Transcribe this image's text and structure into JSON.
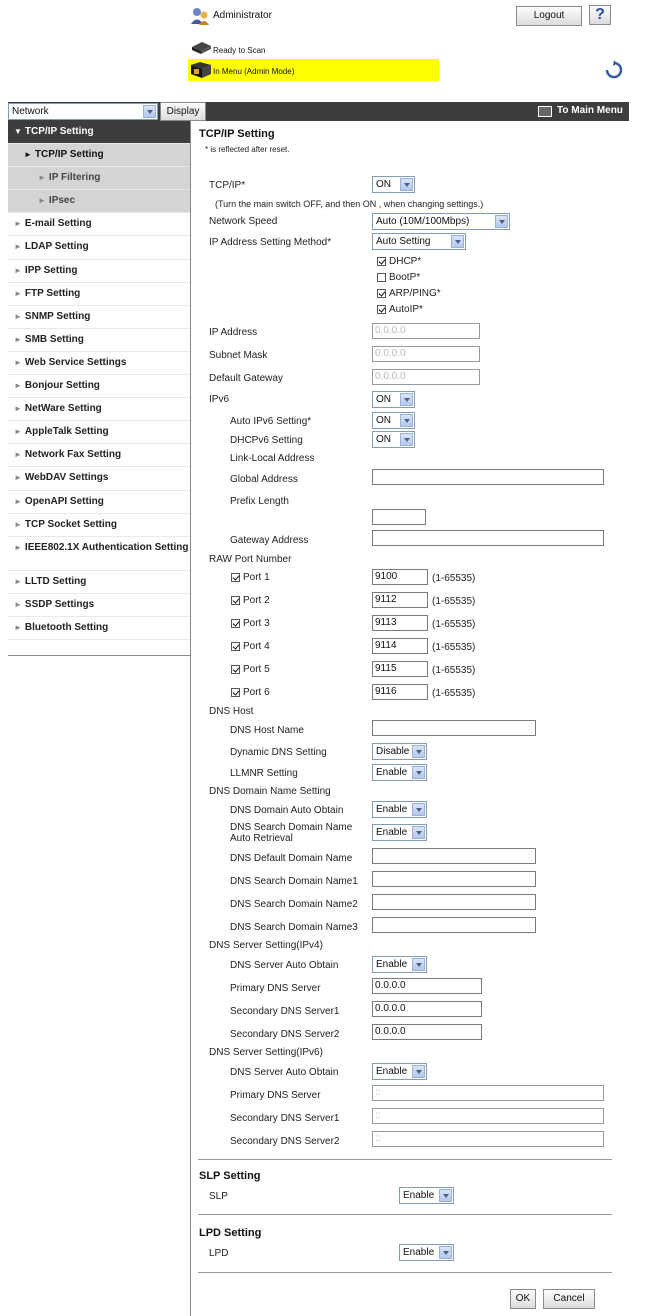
{
  "header": {
    "user_label": "Administrator",
    "logout_label": "Logout",
    "help_label": "?",
    "status_text": "Ready to Scan",
    "mode_text": "In Menu (Admin Mode)"
  },
  "topbar": {
    "category_value": "Network",
    "display_label": "Display",
    "main_menu_label": "To Main Menu"
  },
  "sidebar": [
    {
      "label": "TCP/IP Setting",
      "mark": "▼"
    },
    {
      "label": "TCP/IP Setting",
      "mark": "►"
    },
    {
      "label": "IP Filtering",
      "mark": "►"
    },
    {
      "label": "IPsec",
      "mark": "►"
    },
    {
      "label": "E-mail Setting",
      "mark": "►"
    },
    {
      "label": "LDAP Setting",
      "mark": "►"
    },
    {
      "label": "IPP Setting",
      "mark": "►"
    },
    {
      "label": "FTP Setting",
      "mark": "►"
    },
    {
      "label": "SNMP Setting",
      "mark": "►"
    },
    {
      "label": "SMB Setting",
      "mark": "►"
    },
    {
      "label": "Web Service Settings",
      "mark": "►"
    },
    {
      "label": "Bonjour Setting",
      "mark": "►"
    },
    {
      "label": "NetWare Setting",
      "mark": "►"
    },
    {
      "label": "AppleTalk Setting",
      "mark": "►"
    },
    {
      "label": "Network Fax Setting",
      "mark": "►"
    },
    {
      "label": "WebDAV Settings",
      "mark": "►"
    },
    {
      "label": "OpenAPI Setting",
      "mark": "►"
    },
    {
      "label": "TCP Socket Setting",
      "mark": "►"
    },
    {
      "label": "IEEE802.1X Authentication Setting",
      "mark": "►"
    },
    {
      "label": "LLTD Setting",
      "mark": "►"
    },
    {
      "label": "SSDP Settings",
      "mark": "►"
    },
    {
      "label": "Bluetooth Setting",
      "mark": "►"
    }
  ],
  "main": {
    "title": "TCP/IP Setting",
    "note": "* is reflected after reset.",
    "tcpip_label": "TCP/IP*",
    "tcpip_value": "ON",
    "tcpip_hint": "(Turn the main switch OFF, and then ON , when changing settings.)",
    "speed_label": "Network Speed",
    "speed_value": "Auto (10M/100Mbps)",
    "ipmethod_label": "IP Address Setting Method*",
    "ipmethod_value": "Auto Setting",
    "dhcp_label": "DHCP*",
    "bootp_label": "BootP*",
    "arp_label": "ARP/PING*",
    "autoip_label": "AutoIP*",
    "ipaddr_label": "IP Address",
    "ipaddr_value": "0.0.0.0",
    "subnet_label": "Subnet Mask",
    "subnet_value": "0.0.0.0",
    "gateway_label": "Default Gateway",
    "gateway_value": "0.0.0.0",
    "ipv6_label": "IPv6",
    "ipv6_value": "ON",
    "autoipv6_label": "Auto IPv6 Setting*",
    "autoipv6_value": "ON",
    "dhcpv6_label": "DHCPv6 Setting",
    "dhcpv6_value": "ON",
    "linklocal_label": "Link-Local Address",
    "global_label": "Global Address",
    "prefix_label": "Prefix Length",
    "gwaddr_label": "Gateway Address",
    "rawport_label": "RAW Port Number",
    "ports": [
      {
        "label": "Port 1",
        "value": "9100",
        "range": "(1-65535)"
      },
      {
        "label": "Port 2",
        "value": "9112",
        "range": "(1-65535)"
      },
      {
        "label": "Port 3",
        "value": "9113",
        "range": "(1-65535)"
      },
      {
        "label": "Port 4",
        "value": "9114",
        "range": "(1-65535)"
      },
      {
        "label": "Port 5",
        "value": "9115",
        "range": "(1-65535)"
      },
      {
        "label": "Port 6",
        "value": "9116",
        "range": "(1-65535)"
      }
    ],
    "dnshost_label": "DNS Host",
    "dnshostname_label": "DNS Host Name",
    "dyndns_label": "Dynamic DNS Setting",
    "dyndns_value": "Disable",
    "llmnr_label": "LLMNR Setting",
    "llmnr_value": "Enable",
    "dnsdomain_label": "DNS Domain Name Setting",
    "dnsdomainauto_label": "DNS Domain Auto Obtain",
    "dnsdomainauto_value": "Enable",
    "dnssearchauto_label_1": "DNS Search Domain Name",
    "dnssearchauto_label_2": "Auto Retrieval",
    "dnssearchauto_value": "Enable",
    "dnsdefault_label": "DNS Default Domain Name",
    "dnssearch1_label": "DNS Search Domain Name1",
    "dnssearch2_label": "DNS Search Domain Name2",
    "dnssearch3_label": "DNS Search Domain Name3",
    "dnsv4_label": "DNS Server Setting(IPv4)",
    "dnsv4auto_label": "DNS Server Auto Obtain",
    "dnsv4auto_value": "Enable",
    "dnsv4primary_label": "Primary DNS Server",
    "dnsv4primary_value": "0.0.0.0",
    "dnsv4sec1_label": "Secondary DNS Server1",
    "dnsv4sec1_value": "0.0.0.0",
    "dnsv4sec2_label": "Secondary DNS Server2",
    "dnsv4sec2_value": "0.0.0.0",
    "dnsv6_label": "DNS Server Setting(IPv6)",
    "dnsv6auto_label": "DNS Server Auto Obtain",
    "dnsv6auto_value": "Enable",
    "dnsv6primary_label": "Primary DNS Server",
    "dnsv6primary_value": "::",
    "dnsv6sec1_label": "Secondary DNS Server1",
    "dnsv6sec1_value": "::",
    "dnsv6sec2_label": "Secondary DNS Server2",
    "dnsv6sec2_value": "::",
    "slp_title": "SLP Setting",
    "slp_label": "SLP",
    "slp_value": "Enable",
    "lpd_title": "LPD Setting",
    "lpd_label": "LPD",
    "lpd_value": "Enable",
    "ok_label": "OK",
    "cancel_label": "Cancel"
  },
  "colors": {
    "dark_bar": "#3d3d3d",
    "mode_highlight": "#ffff00",
    "submenu_bg": "#d4d4d4"
  }
}
